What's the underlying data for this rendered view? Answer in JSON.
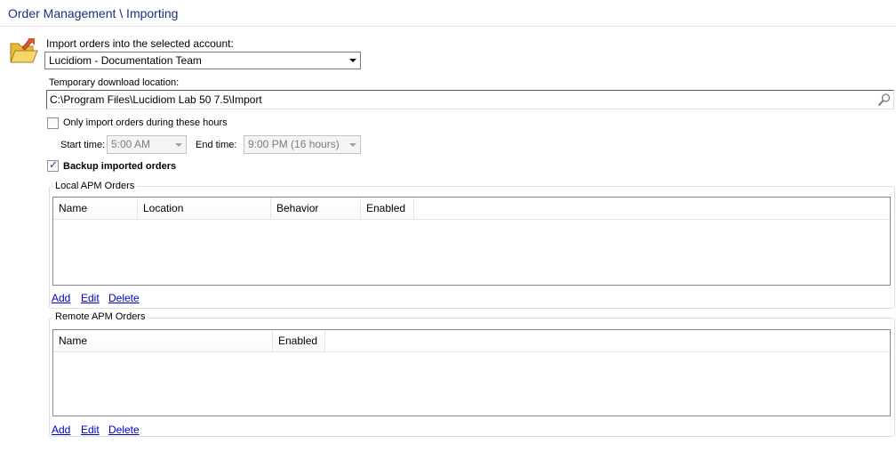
{
  "header": {
    "title": "Order Management \\ Importing"
  },
  "account": {
    "label": "Import orders into the selected account:",
    "selected": "Lucidiom - Documentation Team"
  },
  "download": {
    "label": "Temporary download location:",
    "value": "C:\\Program Files\\Lucidiom Lab 50 7.5\\Import"
  },
  "hours": {
    "checkbox_label": "Only import orders during these hours",
    "checked": false,
    "start_label": "Start time:",
    "start_value": "5:00 AM",
    "end_label": "End time:",
    "end_value": "9:00 PM (16 hours)"
  },
  "backup": {
    "label": "Backup imported orders",
    "checked": true
  },
  "local_apm": {
    "title": "Local APM Orders",
    "columns": [
      "Name",
      "Location",
      "Behavior",
      "Enabled"
    ],
    "rows": [],
    "actions": {
      "add": "Add",
      "edit": "Edit",
      "delete": "Delete"
    }
  },
  "remote_apm": {
    "title": "Remote APM Orders",
    "columns": [
      "Name",
      "Enabled"
    ],
    "rows": [],
    "actions": {
      "add": "Add",
      "edit": "Edit",
      "delete": "Delete"
    }
  },
  "icons": {
    "account": "folder-icon",
    "browse": "magnifier-icon"
  }
}
